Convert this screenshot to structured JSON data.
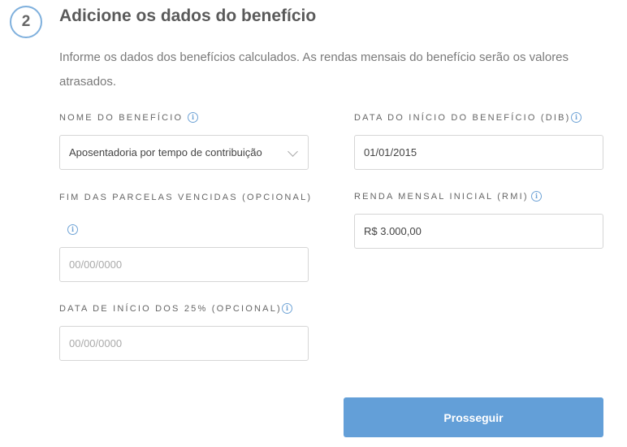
{
  "step": {
    "number": "2",
    "title": "Adicione os dados do benefício"
  },
  "description": "Informe os dados dos benefícios calculados. As rendas mensais do benefício serão os valores atrasados.",
  "fields": {
    "nome_beneficio": {
      "label": "NOME DO BENEFÍCIO",
      "value": "Aposentadoria por tempo de contribuição"
    },
    "dib": {
      "label": "DATA DO INÍCIO DO BENEFÍCIO (DIB)",
      "value": "01/01/2015"
    },
    "fim_parcelas": {
      "label": "FIM DAS PARCELAS VENCIDAS (OPCIONAL)",
      "placeholder": "00/00/0000"
    },
    "rmi": {
      "label": "RENDA MENSAL INICIAL (RMI)",
      "value": "R$ 3.000,00"
    },
    "inicio_25": {
      "label": "DATA DE INÍCIO DOS 25% (OPCIONAL)",
      "placeholder": "00/00/0000"
    }
  },
  "info_icon_glyph": "i",
  "button": {
    "label": "Prosseguir",
    "color": "#639fd8"
  },
  "colors": {
    "accent": "#6fa3d6",
    "step_border": "#7fb0dd"
  }
}
